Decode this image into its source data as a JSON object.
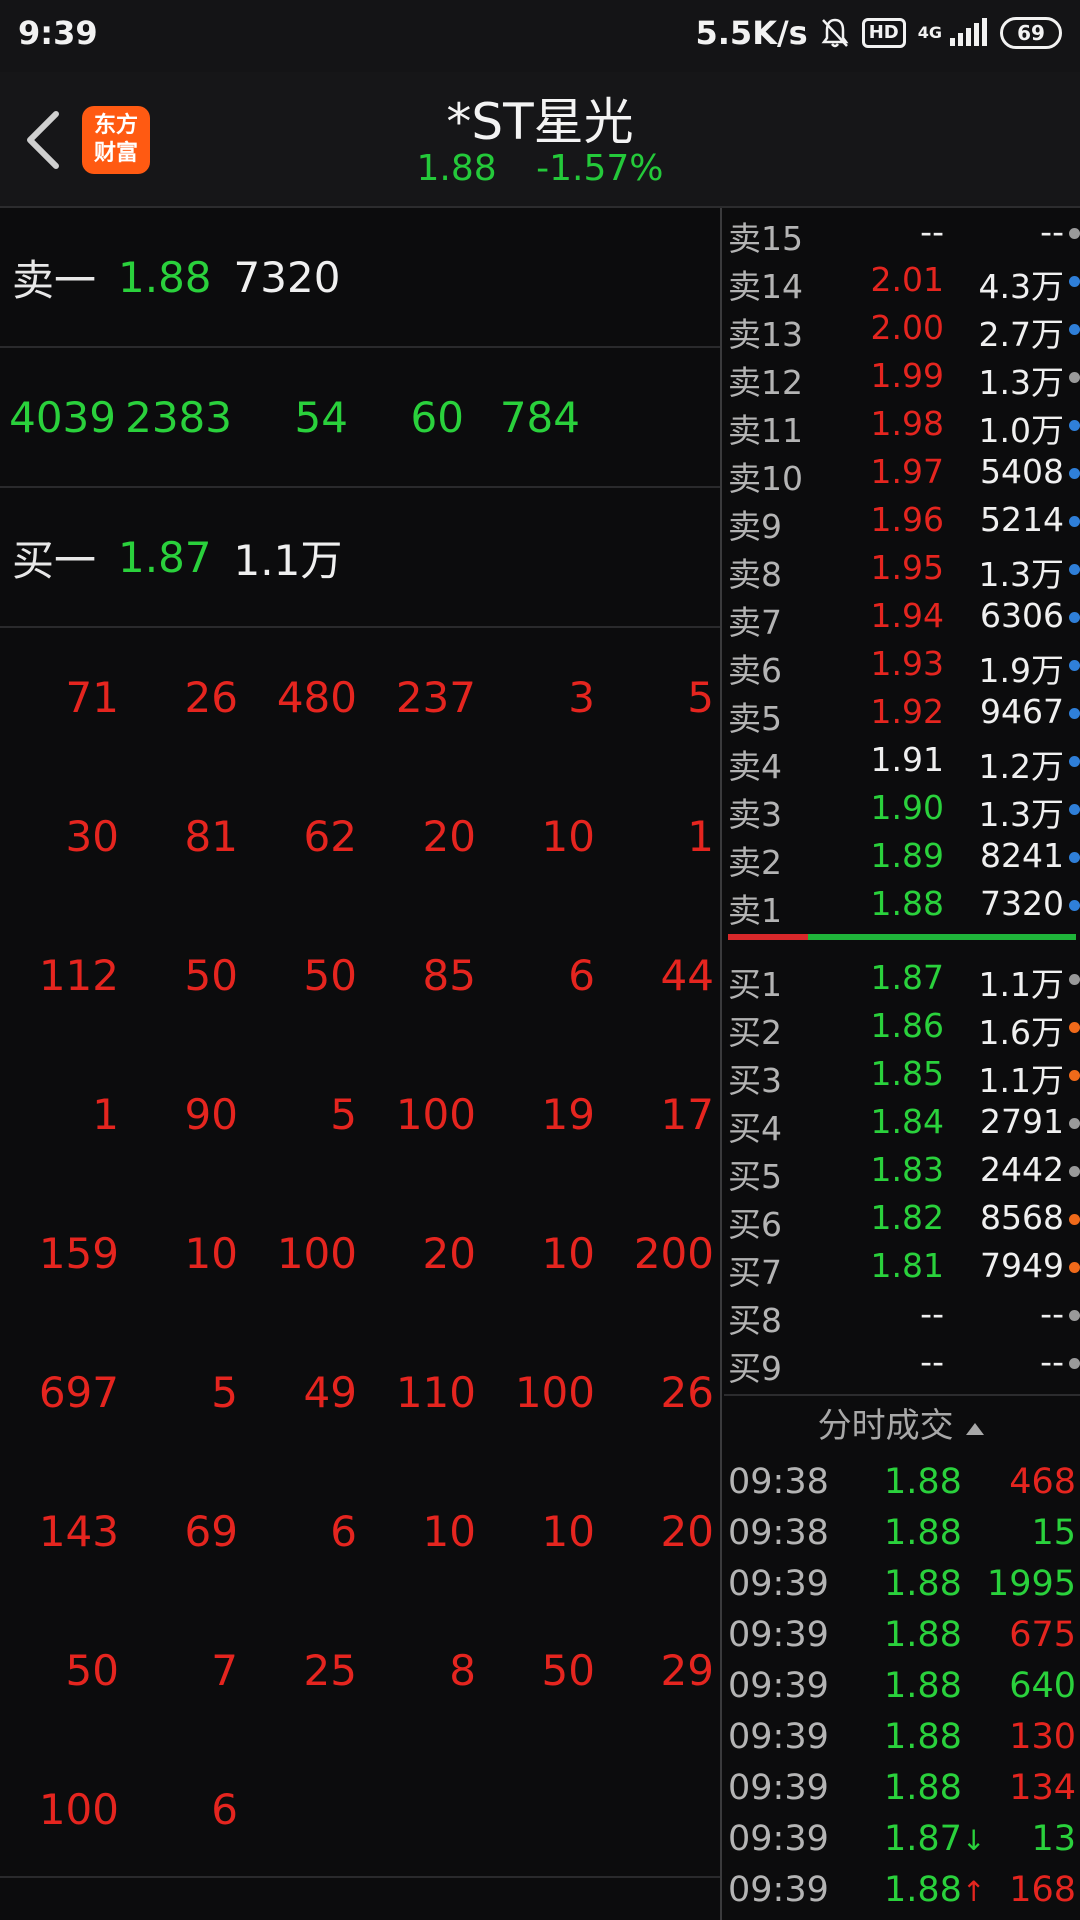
{
  "status_bar": {
    "time": "9:39",
    "net_speed": "5.5K/s",
    "hd_badge": "HD",
    "net_type": "4G",
    "battery": "69"
  },
  "header": {
    "logo_line1": "东方",
    "logo_line2": "财富",
    "title": "*ST星光",
    "price": "1.88",
    "change": "-1.57%"
  },
  "quote": {
    "sell1": {
      "label": "卖一",
      "price": "1.88",
      "volume": "7320"
    },
    "buy1": {
      "label": "买一",
      "price": "1.87",
      "volume": "1.1万"
    },
    "sell_queue": [
      "4039",
      "2383",
      "54",
      "60",
      "784"
    ],
    "buy_queue": [
      [
        "71",
        "26",
        "480",
        "237",
        "3",
        "5"
      ],
      [
        "30",
        "81",
        "62",
        "20",
        "10",
        "1"
      ],
      [
        "112",
        "50",
        "50",
        "85",
        "6",
        "44"
      ],
      [
        "1",
        "90",
        "5",
        "100",
        "19",
        "17"
      ],
      [
        "159",
        "10",
        "100",
        "20",
        "10",
        "200"
      ],
      [
        "697",
        "5",
        "49",
        "110",
        "100",
        "26"
      ],
      [
        "143",
        "69",
        "6",
        "10",
        "10",
        "20"
      ],
      [
        "50",
        "7",
        "25",
        "8",
        "50",
        "29"
      ],
      [
        "100",
        "6",
        "",
        "",
        "",
        ""
      ]
    ]
  },
  "order_book": {
    "sells": [
      {
        "label": "卖15",
        "price": "--",
        "volume": "--",
        "color": "#f0f0f0",
        "dot": "#9a9a9a"
      },
      {
        "label": "卖14",
        "price": "2.01",
        "volume": "4.3万",
        "color": "#e5251f",
        "dot": "#2f7fd8"
      },
      {
        "label": "卖13",
        "price": "2.00",
        "volume": "2.7万",
        "color": "#e5251f",
        "dot": "#2f7fd8"
      },
      {
        "label": "卖12",
        "price": "1.99",
        "volume": "1.3万",
        "color": "#e5251f",
        "dot": "#9a9a9a"
      },
      {
        "label": "卖11",
        "price": "1.98",
        "volume": "1.0万",
        "color": "#e5251f",
        "dot": "#2f7fd8"
      },
      {
        "label": "卖10",
        "price": "1.97",
        "volume": "5408",
        "color": "#e5251f",
        "dot": "#2f7fd8"
      },
      {
        "label": "卖9",
        "price": "1.96",
        "volume": "5214",
        "color": "#e5251f",
        "dot": "#2f7fd8"
      },
      {
        "label": "卖8",
        "price": "1.95",
        "volume": "1.3万",
        "color": "#e5251f",
        "dot": "#2f7fd8"
      },
      {
        "label": "卖7",
        "price": "1.94",
        "volume": "6306",
        "color": "#e5251f",
        "dot": "#2f7fd8"
      },
      {
        "label": "卖6",
        "price": "1.93",
        "volume": "1.9万",
        "color": "#e5251f",
        "dot": "#2f7fd8"
      },
      {
        "label": "卖5",
        "price": "1.92",
        "volume": "9467",
        "color": "#e5251f",
        "dot": "#2f7fd8"
      },
      {
        "label": "卖4",
        "price": "1.91",
        "volume": "1.2万",
        "color": "#f0f0f0",
        "dot": "#2f7fd8"
      },
      {
        "label": "卖3",
        "price": "1.90",
        "volume": "1.3万",
        "color": "#2ad13c",
        "dot": "#2f7fd8"
      },
      {
        "label": "卖2",
        "price": "1.89",
        "volume": "8241",
        "color": "#2ad13c",
        "dot": "#2f7fd8"
      },
      {
        "label": "卖1",
        "price": "1.88",
        "volume": "7320",
        "color": "#2ad13c",
        "dot": "#2f7fd8"
      }
    ],
    "buys": [
      {
        "label": "买1",
        "price": "1.87",
        "volume": "1.1万",
        "color": "#2ad13c",
        "dot": "#9a9a9a"
      },
      {
        "label": "买2",
        "price": "1.86",
        "volume": "1.6万",
        "color": "#2ad13c",
        "dot": "#f06a1a"
      },
      {
        "label": "买3",
        "price": "1.85",
        "volume": "1.1万",
        "color": "#2ad13c",
        "dot": "#f06a1a"
      },
      {
        "label": "买4",
        "price": "1.84",
        "volume": "2791",
        "color": "#2ad13c",
        "dot": "#9a9a9a"
      },
      {
        "label": "买5",
        "price": "1.83",
        "volume": "2442",
        "color": "#2ad13c",
        "dot": "#9a9a9a"
      },
      {
        "label": "买6",
        "price": "1.82",
        "volume": "8568",
        "color": "#2ad13c",
        "dot": "#f06a1a"
      },
      {
        "label": "买7",
        "price": "1.81",
        "volume": "7949",
        "color": "#2ad13c",
        "dot": "#f06a1a"
      },
      {
        "label": "买8",
        "price": "--",
        "volume": "--",
        "color": "#f0f0f0",
        "dot": "#9a9a9a"
      },
      {
        "label": "买9",
        "price": "--",
        "volume": "--",
        "color": "#f0f0f0",
        "dot": "#9a9a9a"
      }
    ]
  },
  "ticks": {
    "header": "分时成交",
    "rows": [
      {
        "time": "09:38",
        "price": "1.88",
        "arrow": "",
        "volume": "468",
        "vol_color": "#e5251f"
      },
      {
        "time": "09:38",
        "price": "1.88",
        "arrow": "",
        "volume": "15",
        "vol_color": "#2ad13c"
      },
      {
        "time": "09:39",
        "price": "1.88",
        "arrow": "",
        "volume": "1995",
        "vol_color": "#2ad13c"
      },
      {
        "time": "09:39",
        "price": "1.88",
        "arrow": "",
        "volume": "675",
        "vol_color": "#e5251f"
      },
      {
        "time": "09:39",
        "price": "1.88",
        "arrow": "",
        "volume": "640",
        "vol_color": "#2ad13c"
      },
      {
        "time": "09:39",
        "price": "1.88",
        "arrow": "",
        "volume": "130",
        "vol_color": "#e5251f"
      },
      {
        "time": "09:39",
        "price": "1.88",
        "arrow": "",
        "volume": "134",
        "vol_color": "#e5251f"
      },
      {
        "time": "09:39",
        "price": "1.87",
        "arrow": "↓",
        "volume": "13",
        "vol_color": "#2ad13c"
      },
      {
        "time": "09:39",
        "price": "1.88",
        "arrow": "↑",
        "volume": "168",
        "vol_color": "#e5251f"
      }
    ]
  }
}
